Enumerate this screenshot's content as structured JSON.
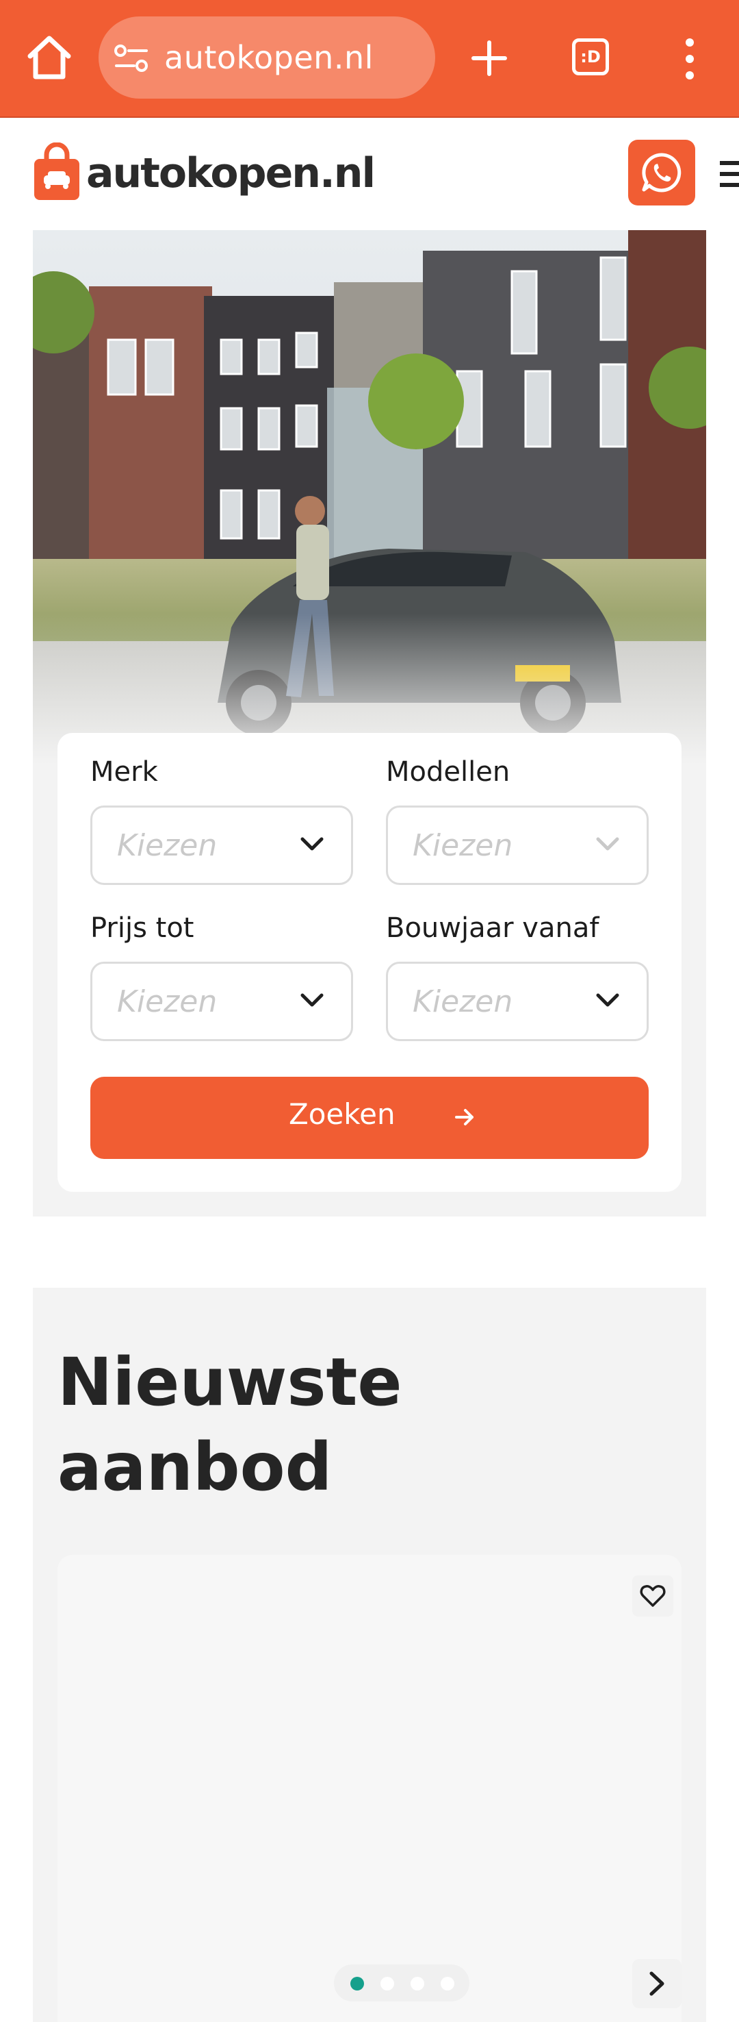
{
  "browser": {
    "url": "autokopen.nl",
    "tab_badge": ":D",
    "icons": [
      "home-icon",
      "site-settings-icon",
      "new-tab-icon",
      "tab-switcher-icon",
      "more-options-icon"
    ]
  },
  "header": {
    "brand": "autokopen.nl",
    "icons": [
      "shopping-bag-logo",
      "whatsapp-icon",
      "hamburger-menu-icon"
    ]
  },
  "search": {
    "fields": [
      {
        "label": "Merk",
        "placeholder": "Kiezen"
      },
      {
        "label": "Modellen",
        "placeholder": "Kiezen"
      },
      {
        "label": "Prijs tot",
        "placeholder": "Kiezen"
      },
      {
        "label": "Bouwjaar vanaf",
        "placeholder": "Kiezen"
      }
    ],
    "button_label": "Zoeken"
  },
  "newest": {
    "title": "Nieuwste aanbod",
    "carousel": {
      "pages": 4,
      "active_page": 1
    }
  },
  "colors": {
    "brand_orange": "#f15d33",
    "active_dot": "#15a08c",
    "section_bg": "#f3f3f3"
  }
}
